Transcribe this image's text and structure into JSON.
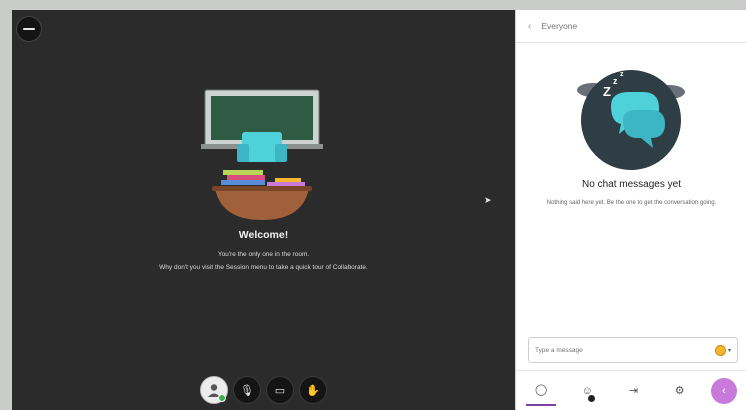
{
  "stage": {
    "welcome_title": "Welcome!",
    "welcome_line1": "You're the only one in the room.",
    "welcome_line2": "Why don't you visit the Session menu to take a quick tour of Collaborate."
  },
  "controls": [
    {
      "name": "profile-button",
      "icon": "avatar-icon"
    },
    {
      "name": "microphone-button",
      "icon": "mic-muted-icon",
      "glyph": "🎙"
    },
    {
      "name": "camera-button",
      "icon": "camera-off-icon",
      "glyph": "▭"
    },
    {
      "name": "hand-raise-button",
      "icon": "hand-icon",
      "glyph": "✋"
    }
  ],
  "panel": {
    "header_title": "Everyone",
    "empty_title": "No chat messages yet",
    "empty_body": "Nothing said here yet. Be the one to get the conversation going.",
    "composer_placeholder": "Type a message"
  },
  "tabs": [
    {
      "name": "tab-chat",
      "icon": "chat-icon",
      "glyph": "◯"
    },
    {
      "name": "tab-attendees",
      "icon": "attendees-icon",
      "glyph": "☺"
    },
    {
      "name": "tab-share-content",
      "icon": "share-icon",
      "glyph": "⇥"
    },
    {
      "name": "tab-settings",
      "icon": "settings-icon",
      "glyph": "⚙"
    },
    {
      "name": "tab-collapse",
      "icon": "collapse-icon",
      "glyph": "‹"
    }
  ],
  "colors": {
    "stage_bg": "#2b2b2b",
    "accent": "#7d3fa8",
    "send_bg": "#c77ad9",
    "illustration_teal": "#4fd1d9",
    "status_online": "#37b24d"
  }
}
